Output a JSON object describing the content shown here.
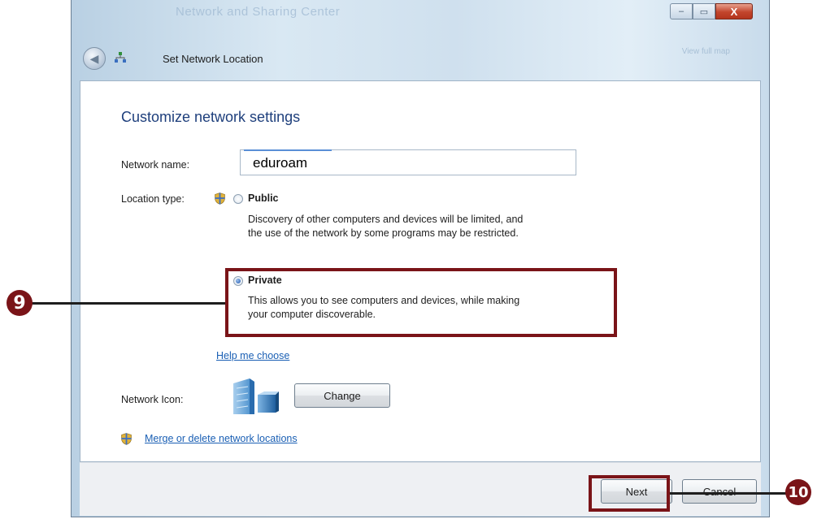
{
  "window": {
    "ghost_title": "Network and Sharing Center",
    "ghost_right": "View full map",
    "title": "Set Network Location",
    "controls": {
      "minimize": "–",
      "maximize": "▭",
      "close": "X"
    }
  },
  "page": {
    "heading": "Customize network settings",
    "network_name_label": "Network name:",
    "network_name_value": "eduroam",
    "location_type_label": "Location type:",
    "public": {
      "title": "Public",
      "desc1": "Discovery of other computers and devices will be limited, and",
      "desc2": "the use of the network by some programs may be restricted.",
      "selected": false
    },
    "private": {
      "title": "Private",
      "desc1": "This allows you to see computers and devices, while making",
      "desc2": "your computer discoverable.",
      "selected": true
    },
    "help_link": "Help me choose",
    "network_icon_label": "Network Icon:",
    "change_button": "Change",
    "merge_link": "Merge or delete network locations"
  },
  "footer": {
    "next_button": "Next",
    "cancel_button": "Cancel"
  },
  "callouts": {
    "step9": "9",
    "step10": "10"
  },
  "colors": {
    "callout": "#7a1418",
    "link": "#1a5fb4",
    "heading": "#1e3f7c"
  }
}
